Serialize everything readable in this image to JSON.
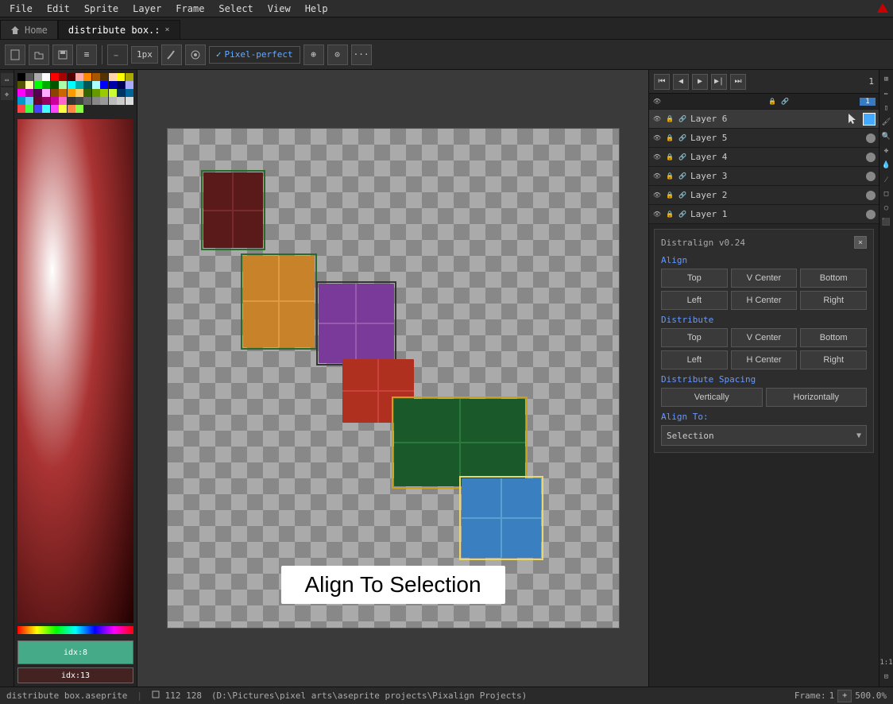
{
  "menubar": {
    "items": [
      "File",
      "Edit",
      "Sprite",
      "Layer",
      "Frame",
      "Select",
      "View",
      "Help"
    ]
  },
  "tabs": [
    {
      "label": "Home",
      "active": false,
      "closable": false
    },
    {
      "label": "distribute box.:",
      "active": true,
      "closable": true
    }
  ],
  "toolbar": {
    "pixel_size": "1px",
    "pixel_perfect": "Pixel-perfect",
    "pixel_perfect_checked": true
  },
  "timeline": {
    "frame_num": "1"
  },
  "layers": [
    {
      "name": "Layer 6",
      "active": true,
      "has_blue_dot": true
    },
    {
      "name": "Layer 5",
      "active": false,
      "has_blue_dot": false
    },
    {
      "name": "Layer 4",
      "active": false,
      "has_blue_dot": false
    },
    {
      "name": "Layer 3",
      "active": false,
      "has_blue_dot": false
    },
    {
      "name": "Layer 2",
      "active": false,
      "has_blue_dot": false
    },
    {
      "name": "Layer 1",
      "active": false,
      "has_blue_dot": false
    }
  ],
  "distralign": {
    "title": "Distralign v0.24",
    "sections": {
      "align": {
        "label": "Align",
        "row1": [
          "Top",
          "V Center",
          "Bottom"
        ],
        "row2": [
          "Left",
          "H Center",
          "Right"
        ]
      },
      "distribute": {
        "label": "Distribute",
        "row1": [
          "Top",
          "V Center",
          "Bottom"
        ],
        "row2": [
          "Left",
          "H Center",
          "Right"
        ]
      },
      "distribute_spacing": {
        "label": "Distribute Spacing",
        "row1": [
          "Vertically",
          "Horizontally"
        ]
      },
      "align_to": {
        "label": "Align To:",
        "value": "Selection"
      }
    }
  },
  "tooltip": "Align To Selection",
  "statusbar": {
    "filename": "distribute box.aseprite",
    "dimensions": "112 128",
    "path": "(D:\\Pictures\\pixel arts\\aseprite projects\\Pixalign Projects)",
    "frame_label": "Frame:",
    "frame_num": "1",
    "zoom": "500.0%"
  },
  "colors": {
    "palette": [
      "#000",
      "#fff",
      "#f00",
      "#0f0",
      "#00f",
      "#ff0",
      "#0ff",
      "#f0f",
      "#800",
      "#080",
      "#008",
      "#880",
      "#088",
      "#808",
      "#400",
      "#040",
      "#004",
      "#440",
      "#044",
      "#404",
      "#f80",
      "#08f",
      "#f08",
      "#8f0",
      "#0f8",
      "#80f",
      "#fa0",
      "#0af",
      "#f0a",
      "#af0",
      "#0fa",
      "#a0f",
      "#c84",
      "#48c",
      "#c48",
      "#8c4",
      "#48c",
      "#84c",
      "#642",
      "#246",
      "#624",
      "#462",
      "#264",
      "#426",
      "#ffc",
      "#cff",
      "#fcf",
      "#fcc",
      "#ccf",
      "#cfc",
      "#eee",
      "#ddd",
      "#bbb",
      "#999",
      "#777",
      "#555",
      "#333",
      "#222",
      "#111",
      "#000",
      "#aaa",
      "#666",
      "#f44",
      "#4f4",
      "#44f",
      "#ff4",
      "#4ff",
      "#f4f",
      "#a22",
      "#2a2",
      "#22a",
      "#aa2",
      "#2aa",
      "#a2a",
      "#622",
      "#262",
      "#226",
      "#662",
      "#266",
      "#626",
      "#faa",
      "#afa",
      "#aaf",
      "#ffa",
      "#aff",
      "#faf",
      "#c00",
      "#0c0",
      "#00c",
      "#cc0",
      "#0cc",
      "#c0c",
      "#e60",
      "#06e",
      "#e06",
      "#6e0",
      "#06e",
      "#60e",
      "#b73",
      "#37b",
      "#b37",
      "#7b3",
      "#37b",
      "#73b",
      "#d95",
      "#59d",
      "#d59",
      "#9d5",
      "#59d",
      "#95d",
      "#fbd",
      "#dbf",
      "#fdb",
      "#bfd",
      "#dbf",
      "#bdf"
    ]
  }
}
